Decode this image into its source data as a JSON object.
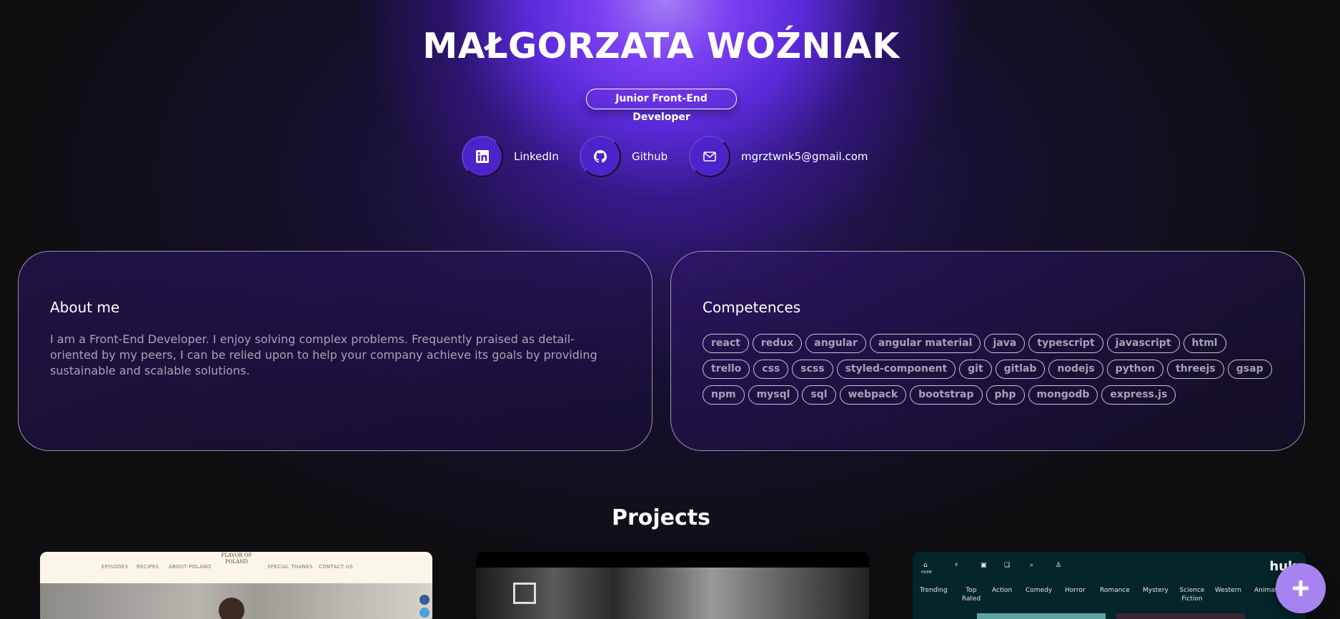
{
  "header": {
    "name": "MAŁGORZATA WOŹNIAK",
    "role": "Junior Front-End Developer"
  },
  "links": [
    {
      "label": "LinkedIn",
      "icon": "linkedin-icon"
    },
    {
      "label": "Github",
      "icon": "github-icon"
    },
    {
      "label": "mgrztwnk5@gmail.com",
      "icon": "envelope-icon"
    }
  ],
  "about": {
    "title": "About me",
    "text": "I am a Front-End Developer. I enjoy solving complex problems. Frequently praised as detail-oriented by my peers, I can be relied upon to help your company achieve its goals by providing sustainable and scalable solutions."
  },
  "competences": {
    "title": "Competences",
    "skills": [
      "react",
      "redux",
      "angular",
      "angular material",
      "java",
      "typescript",
      "javascript",
      "html",
      "trello",
      "css",
      "scss",
      "styled-component",
      "git",
      "gitlab",
      "nodejs",
      "python",
      "threejs",
      "gsap",
      "npm",
      "mysql",
      "sql",
      "webpack",
      "bootstrap",
      "php",
      "mongodb",
      "express.js"
    ]
  },
  "projects": {
    "title": "Projects",
    "project1": {
      "nav": [
        "EPISODES",
        "RECIPES",
        "ABOUT POLAND",
        "SPECIAL THANKS",
        "CONTACT US"
      ],
      "logo_text": "FLAVOR OF POLAND"
    },
    "project3": {
      "brand": "hulu",
      "home_label": "HOME",
      "categories": [
        "Trending",
        "Top Rated",
        "Action",
        "Comedy",
        "Horror",
        "Romance",
        "Mystery",
        "Science Fiction",
        "Western",
        "Animation"
      ]
    }
  },
  "colors": {
    "accent": "#7a3ff0",
    "fab": "#a783f2",
    "background": "#0e0e10"
  }
}
